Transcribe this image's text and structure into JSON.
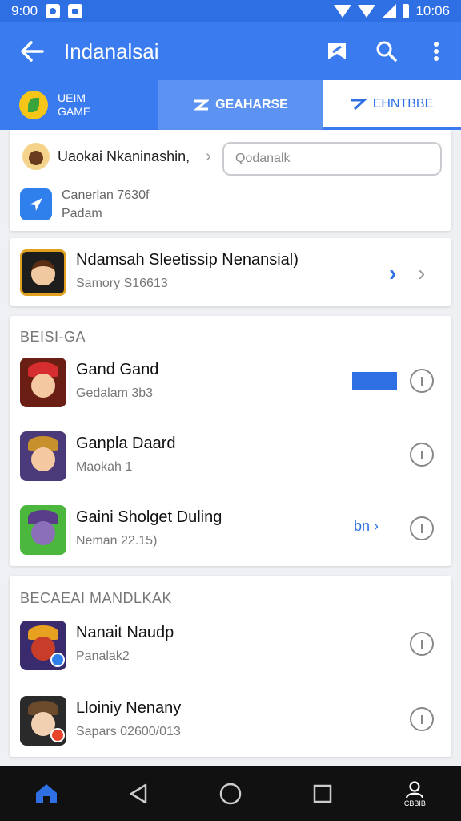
{
  "status_bar": {
    "left_time": "9:00",
    "right_time": "10:06"
  },
  "app_bar": {
    "title": "Indanalsai"
  },
  "tabs": {
    "game_label_line1": "UEIM",
    "game_label_line2": "GAME",
    "mid_label": "GEAHARSE",
    "right_label": "EHNTBBE"
  },
  "account_card": {
    "name": "Uaokai Nkaninashin,",
    "search_placeholder": "Qodanalk",
    "secondary_line1": "Canerlan 7630f",
    "secondary_line2": "Padam"
  },
  "featured": {
    "title": "Ndamsah Sleetissip Nenansial)",
    "subtitle": "Samory S16613"
  },
  "section1": {
    "heading": "BEISI-GA",
    "items": [
      {
        "title": "Gand Gand",
        "subtitle": "Gedalam 3b3"
      },
      {
        "title": "Ganpla Daard",
        "subtitle": "Maokah 1"
      },
      {
        "title": "Gaini Sholget Duling",
        "subtitle": "Neman 22.15)",
        "link": "bn"
      }
    ]
  },
  "section2": {
    "heading": "BECAEAI MANDLKAK",
    "items": [
      {
        "title": "Nanait Naudp",
        "subtitle": "Panalak2"
      },
      {
        "title": "Lloiniy Nenany",
        "subtitle": "Sapars 02600/013"
      }
    ]
  },
  "nav_bar": {
    "profile_label": "CBBIB"
  },
  "colors": {
    "primary": "#3a7cf0",
    "status_bar": "#2f6fe4",
    "accent": "#2f6fe4"
  }
}
